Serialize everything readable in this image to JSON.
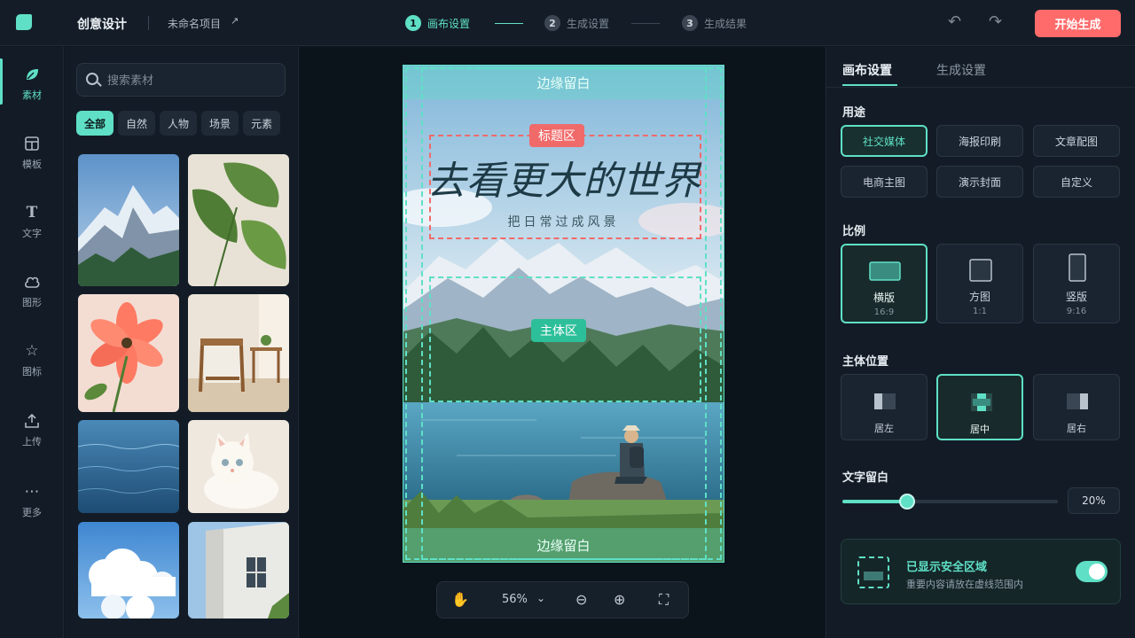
{
  "header": {
    "app_title": "创意设计",
    "project_name": "未命名项目",
    "steps": [
      {
        "num": "1",
        "label": "画布设置",
        "active": true
      },
      {
        "num": "2",
        "label": "生成设置",
        "active": false
      },
      {
        "num": "3",
        "label": "生成结果",
        "active": false
      }
    ],
    "primary_action": "开始生成"
  },
  "rail": {
    "items": [
      {
        "label": "素材",
        "icon": "leaf-icon"
      },
      {
        "label": "模板",
        "icon": "template-icon"
      },
      {
        "label": "文字",
        "icon": "text-icon"
      },
      {
        "label": "图形",
        "icon": "shape-icon"
      },
      {
        "label": "图标",
        "icon": "star-icon"
      },
      {
        "label": "上传",
        "icon": "upload-icon"
      },
      {
        "label": "更多",
        "icon": "more-icon"
      }
    ],
    "active_index": 0
  },
  "assets": {
    "search_placeholder": "搜索素材",
    "filters": [
      "全部",
      "自然",
      "人物",
      "场景",
      "元素"
    ],
    "active_filter": 0,
    "thumbnails": [
      "mountain-photo",
      "leaf-photo",
      "flower-photo",
      "chair-photo",
      "ocean-photo",
      "cat-photo",
      "sky-photo",
      "building-photo"
    ]
  },
  "canvas": {
    "margin_top_label": "边缘留白",
    "margin_bottom_label": "边缘留白",
    "title_zone_label": "标题区",
    "subject_zone_label": "主体区",
    "headline": "去看更大的世界",
    "subheadline": "把日常过成风景",
    "zoom": "56%"
  },
  "props": {
    "tabs": [
      "画布设置",
      "生成设置"
    ],
    "active_tab": 0,
    "usage_title": "用途",
    "usage_options": [
      "社交媒体",
      "海报印刷",
      "文章配图",
      "电商主图",
      "演示封面",
      "自定义"
    ],
    "usage_active": 0,
    "ratio_title": "比例",
    "ratios": [
      {
        "label": "横版",
        "value": "16:9"
      },
      {
        "label": "方图",
        "value": "1:1"
      },
      {
        "label": "竖版",
        "value": "9:16"
      }
    ],
    "ratio_active": 0,
    "position_title": "主体位置",
    "positions": [
      "居左",
      "居中",
      "居右"
    ],
    "position_active": 1,
    "text_margin_title": "文字留白",
    "text_margin_value": "20%",
    "text_margin_fraction": 0.3,
    "safe_title": "已显示安全区域",
    "safe_desc": "重要内容请放在虚线范围内",
    "safe_on": true
  },
  "colors": {
    "accent": "#5fe0c6",
    "primary_button": "#ff6b6b",
    "title_zone": "#f06a6a",
    "subject_zone": "#2dbf9a"
  }
}
